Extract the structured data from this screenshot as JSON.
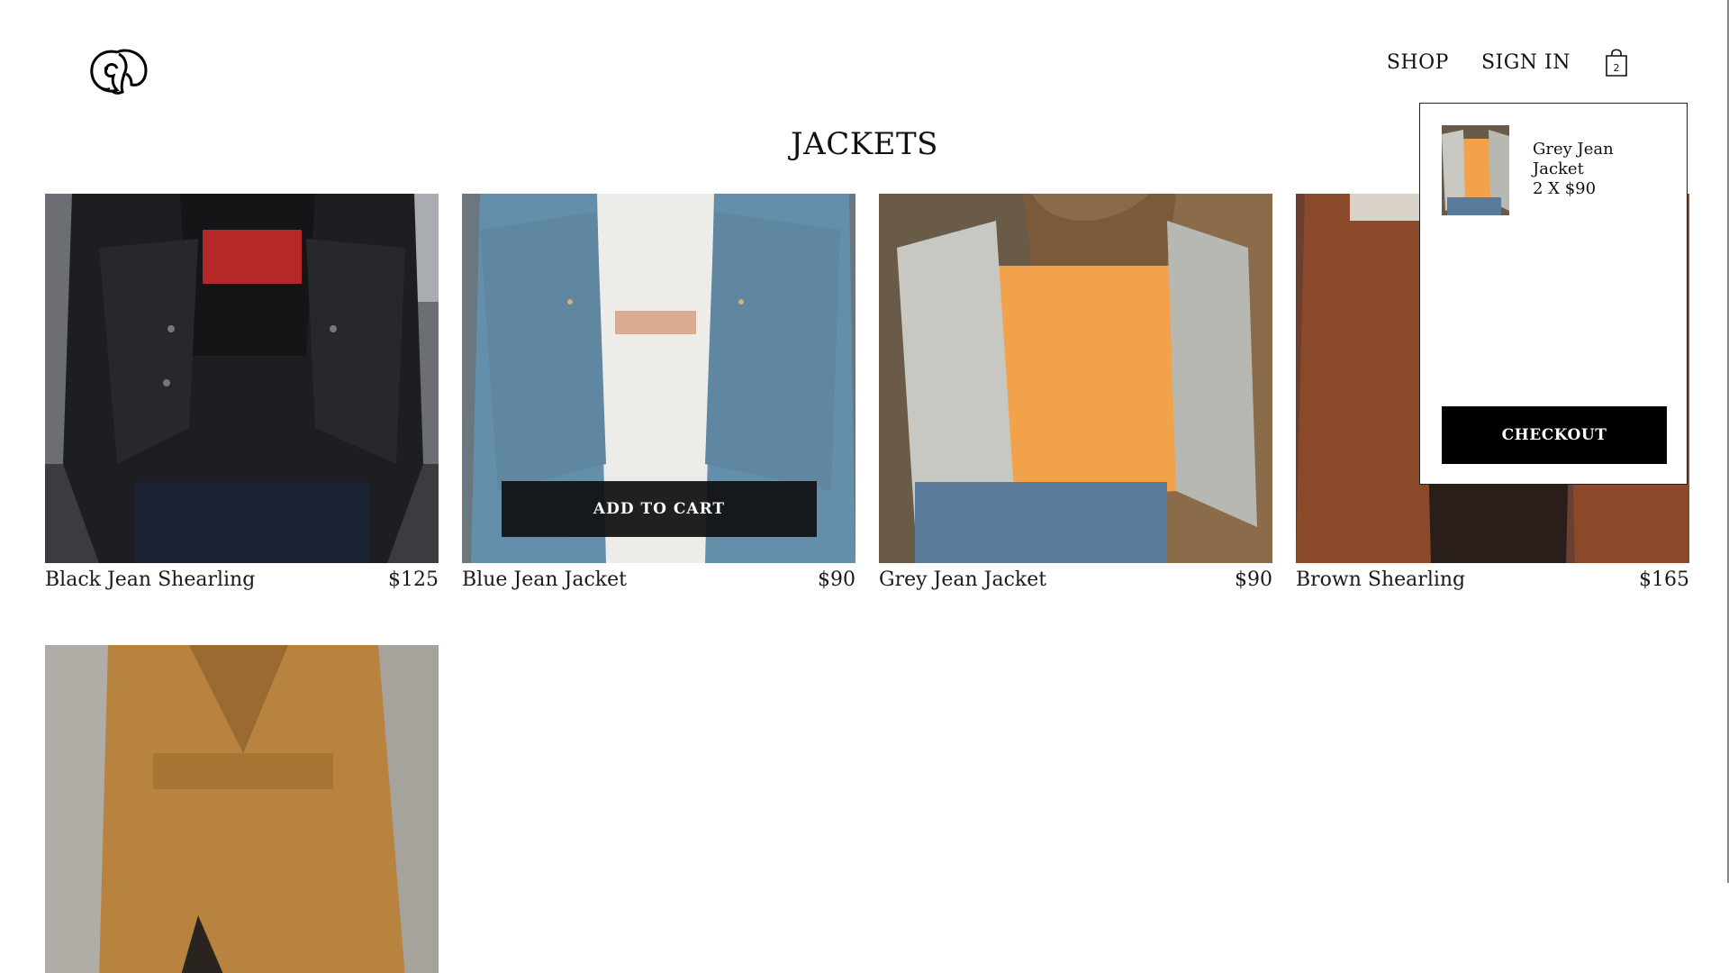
{
  "header": {
    "logo_icon": "elephant-logo-icon",
    "nav": {
      "shop_label": "SHOP",
      "signin_label": "SIGN IN"
    },
    "cart": {
      "icon": "shopping-bag-icon",
      "count": "2"
    }
  },
  "page": {
    "title": "JACKETS"
  },
  "products": [
    {
      "name": "Black Jean Shearling",
      "price": "$125"
    },
    {
      "name": "Blue Jean Jacket",
      "price": "$90",
      "hover_button": "ADD TO CART"
    },
    {
      "name": "Grey Jean Jacket",
      "price": "$90"
    },
    {
      "name": "Brown Shearling",
      "price": "$165"
    },
    {
      "name": "",
      "price": ""
    }
  ],
  "cart_dropdown": {
    "items": [
      {
        "name": "Grey Jean Jacket",
        "quantity_price": "2 X $90"
      }
    ],
    "checkout_label": "CHECKOUT"
  },
  "colors": {
    "button_bg": "#000000",
    "button_text": "#ffffff",
    "text": "#111111"
  }
}
